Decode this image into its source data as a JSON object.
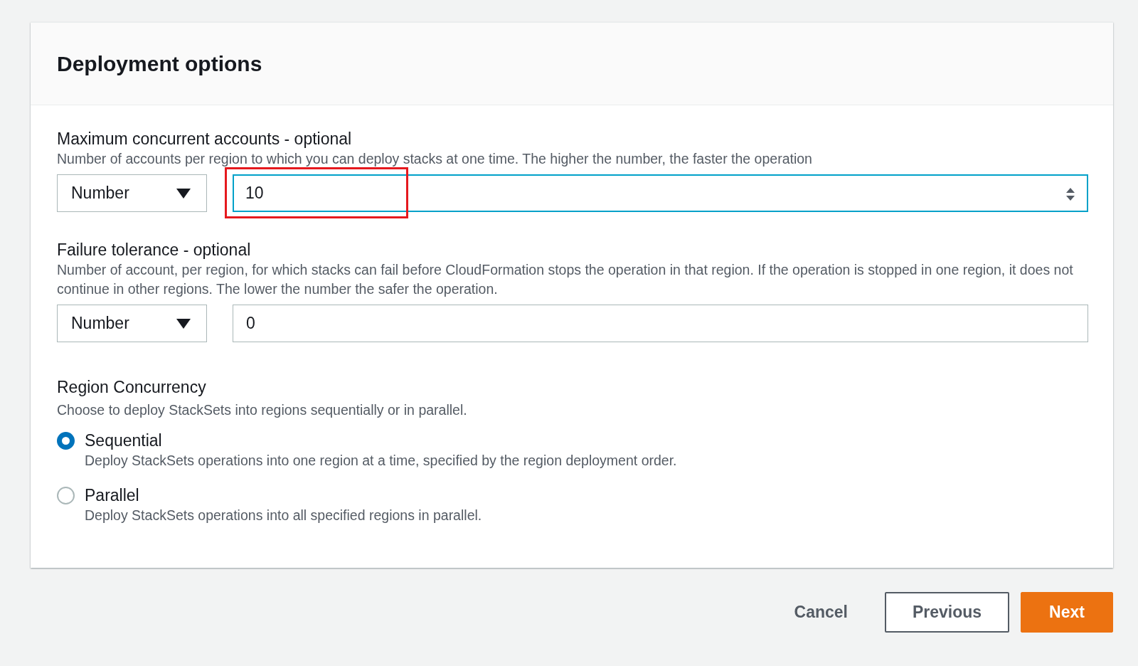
{
  "panel": {
    "title": "Deployment options"
  },
  "settings": [
    {
      "label": "Maximum concurrent accounts - optional",
      "description": "Number of accounts per region to which you can deploy stacks at one time. The higher the number, the faster the operation",
      "type_select": "Number",
      "value": "10",
      "focused": true,
      "highlighted": true
    },
    {
      "label": "Failure tolerance - optional",
      "description": "Number of account, per region, for which stacks can fail before CloudFormation stops the operation in that region. If the operation is stopped in one region, it does not continue in other regions. The lower the number the safer the operation.",
      "type_select": "Number",
      "value": "0",
      "focused": false,
      "highlighted": false
    }
  ],
  "region_concurrency": {
    "label": "Region Concurrency",
    "description": "Choose to deploy StackSets into regions sequentially or in parallel.",
    "options": [
      {
        "label": "Sequential",
        "description": "Deploy StackSets operations into one region at a time, specified by the region deployment order.",
        "selected": true
      },
      {
        "label": "Parallel",
        "description": "Deploy StackSets operations into all specified regions in parallel.",
        "selected": false
      }
    ]
  },
  "actions": [
    {
      "label": "Cancel",
      "kind": "link"
    },
    {
      "label": "Previous",
      "kind": "secondary"
    },
    {
      "label": "Next",
      "kind": "primary"
    }
  ]
}
